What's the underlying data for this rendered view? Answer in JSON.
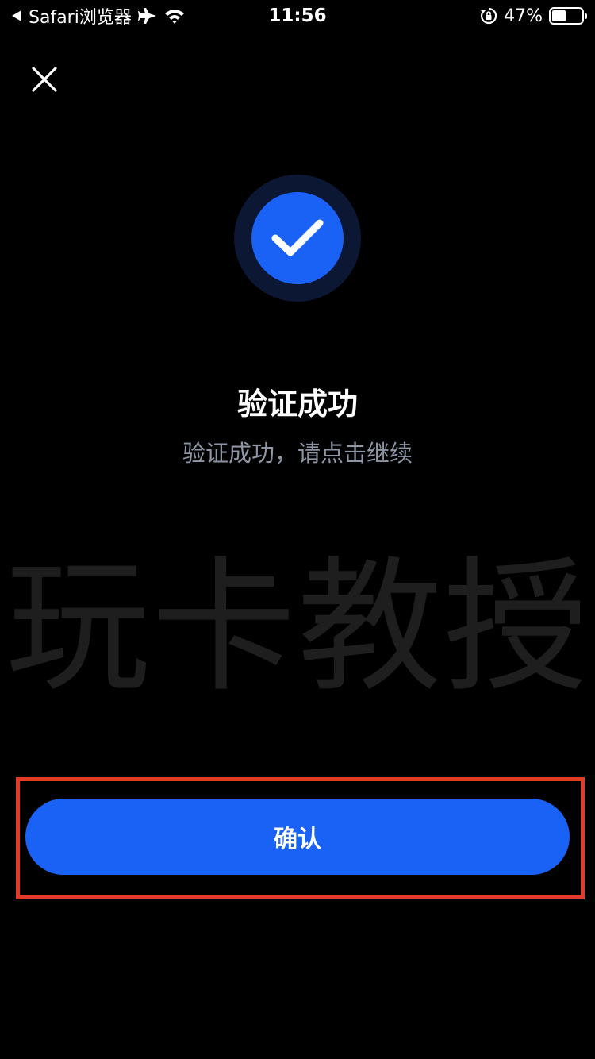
{
  "status_bar": {
    "back_app": "Safari浏览器",
    "time": "11:56",
    "battery_percent": "47%",
    "battery_level": 0.47,
    "icons": [
      "back-arrow-icon",
      "airplane-icon",
      "wifi-icon",
      "orientation-lock-icon",
      "battery-icon"
    ]
  },
  "header": {
    "close_icon": "close-icon"
  },
  "result": {
    "icon": "checkmark-icon",
    "title": "验证成功",
    "subtitle": "验证成功，请点击继续"
  },
  "watermark": {
    "text": "玩卡教授"
  },
  "actions": {
    "confirm_label": "确认"
  },
  "colors": {
    "background": "#000000",
    "accent": "#1a62f5",
    "subtitle": "#8e96a6",
    "highlight": "#e53a2a"
  }
}
